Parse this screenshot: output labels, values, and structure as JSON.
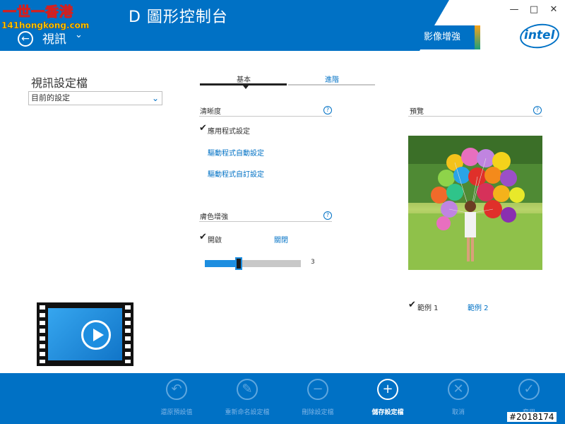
{
  "header": {
    "app_title": "D 圖形控制台",
    "section_title": "視訊",
    "section_chevron": "⌄",
    "back_glyph": "←",
    "active_tab": "影像增強",
    "intel_logo": "intel",
    "minimize": "—",
    "maximize": "□",
    "close": "✕"
  },
  "watermark": {
    "line1": "一世一香港",
    "line2": "141hongkong.com"
  },
  "profile": {
    "title": "視訊設定檔",
    "selected": "目前的設定",
    "chevron": "⌄"
  },
  "tabs": {
    "basic": "基本",
    "advanced": "進階"
  },
  "sharpness": {
    "title": "清晰度",
    "help": "?",
    "check_glyph": "✔",
    "options": [
      "應用程式設定",
      "驅動程式自動設定",
      "驅動程式自訂設定"
    ]
  },
  "color_enhance": {
    "title": "膚色增強",
    "help": "?",
    "on_label": "開啟",
    "off_label": "關閉",
    "slider_value": "3",
    "slider_level_fraction": 0.35
  },
  "preview": {
    "title": "預覽",
    "help": "?",
    "sample1": "範例 1",
    "sample2": "範例 2"
  },
  "toolbar": {
    "items": [
      {
        "label": "還原預設值",
        "icon": "↶"
      },
      {
        "label": "重新命名設定檔",
        "icon": "✎"
      },
      {
        "label": "刪除設定檔",
        "icon": "−"
      },
      {
        "label": "儲存設定檔",
        "icon": "+"
      },
      {
        "label": "取消",
        "icon": "✕"
      },
      {
        "label": "套用",
        "icon": "✓"
      }
    ],
    "image_id": "#2018174"
  }
}
